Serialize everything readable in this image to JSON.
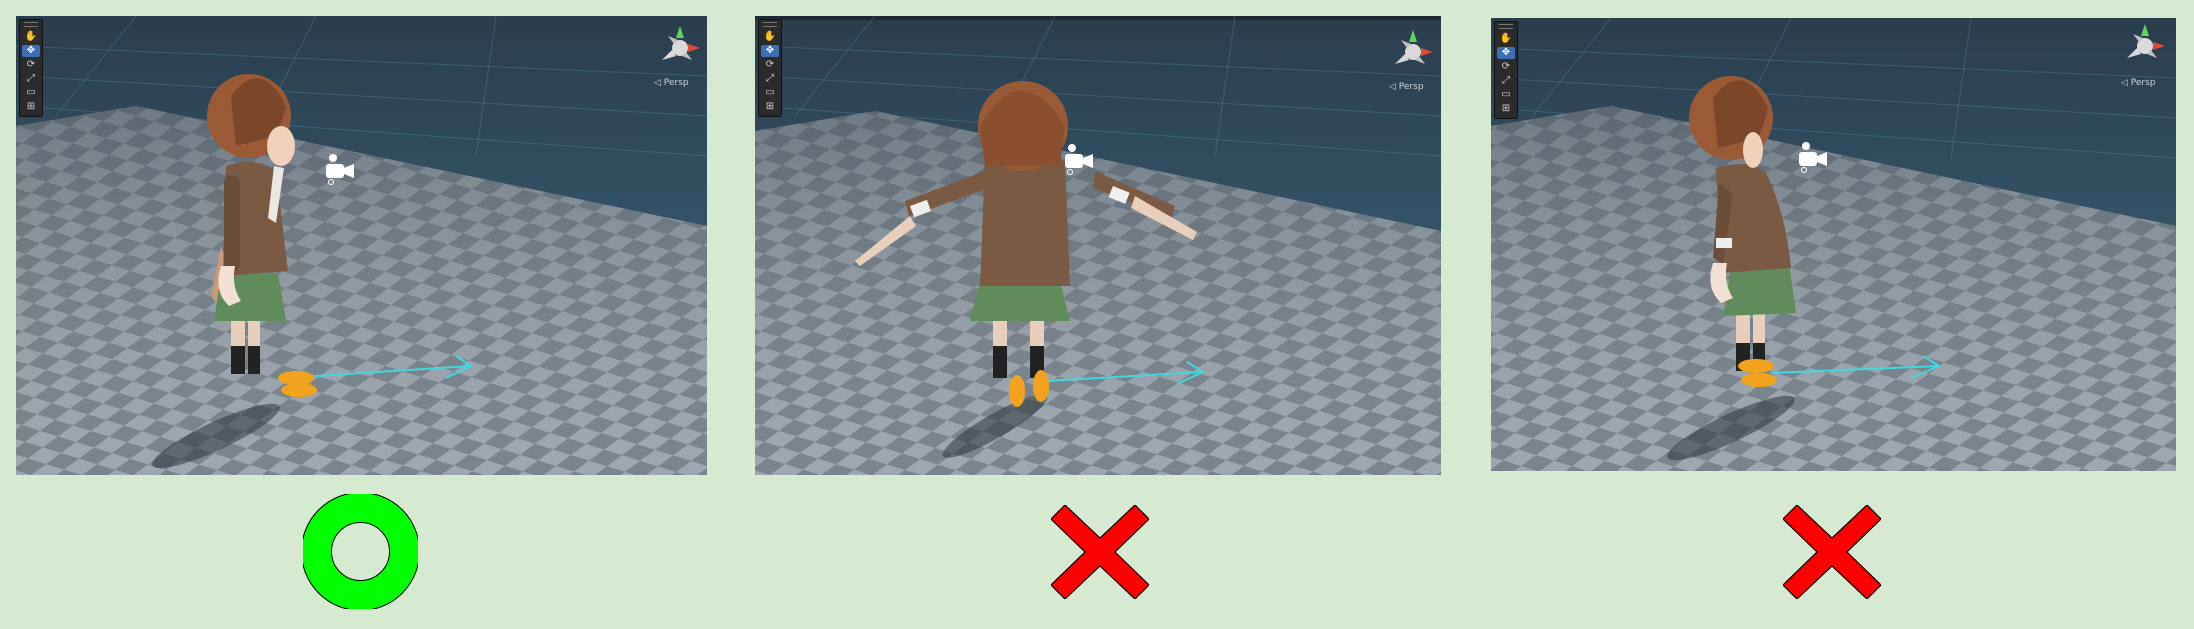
{
  "panels": [
    {
      "toolbar": {
        "tools": [
          {
            "icon": "hand-tool-icon",
            "glyph": "✋"
          },
          {
            "icon": "move-tool-icon",
            "glyph": "✥"
          },
          {
            "icon": "rotate-tool-icon",
            "glyph": "⟳"
          },
          {
            "icon": "scale-tool-icon",
            "glyph": "⤢"
          },
          {
            "icon": "rect-tool-icon",
            "glyph": "▭"
          },
          {
            "icon": "transform-tool-icon",
            "glyph": "⊞"
          }
        ],
        "active_tool": 1
      },
      "persp_label": "◁ Persp",
      "pose": "side-arms-down",
      "verdict": "correct"
    },
    {
      "toolbar": {
        "tools": [
          {
            "icon": "hand-tool-icon",
            "glyph": "✋"
          },
          {
            "icon": "move-tool-icon",
            "glyph": "✥"
          },
          {
            "icon": "rotate-tool-icon",
            "glyph": "⟳"
          },
          {
            "icon": "scale-tool-icon",
            "glyph": "⤢"
          },
          {
            "icon": "rect-tool-icon",
            "glyph": "▭"
          },
          {
            "icon": "transform-tool-icon",
            "glyph": "⊞"
          }
        ],
        "active_tool": 1
      },
      "persp_label": "◁ Persp",
      "pose": "t-pose",
      "verdict": "incorrect"
    },
    {
      "toolbar": {
        "tools": [
          {
            "icon": "hand-tool-icon",
            "glyph": "✋"
          },
          {
            "icon": "move-tool-icon",
            "glyph": "✥"
          },
          {
            "icon": "rotate-tool-icon",
            "glyph": "⟳"
          },
          {
            "icon": "scale-tool-icon",
            "glyph": "⤢"
          },
          {
            "icon": "rect-tool-icon",
            "glyph": "▭"
          },
          {
            "icon": "transform-tool-icon",
            "glyph": "⊞"
          }
        ],
        "active_tool": 1
      },
      "persp_label": "◁ Persp",
      "pose": "side-bent",
      "verdict": "incorrect"
    }
  ],
  "colors": {
    "page_background": "#d6ead2",
    "sky_top": "#2a3d4d",
    "sky_bottom": "#3d6a82",
    "floor": "#8e979f",
    "checker_dark": "#6f7982",
    "correct_mark": "#00ff00",
    "incorrect_mark": "#ff0000",
    "direction_arrow": "#40d8e0",
    "hair": "#9a5a35",
    "jacket": "#7a5a43",
    "skirt": "#5f8c5a"
  }
}
